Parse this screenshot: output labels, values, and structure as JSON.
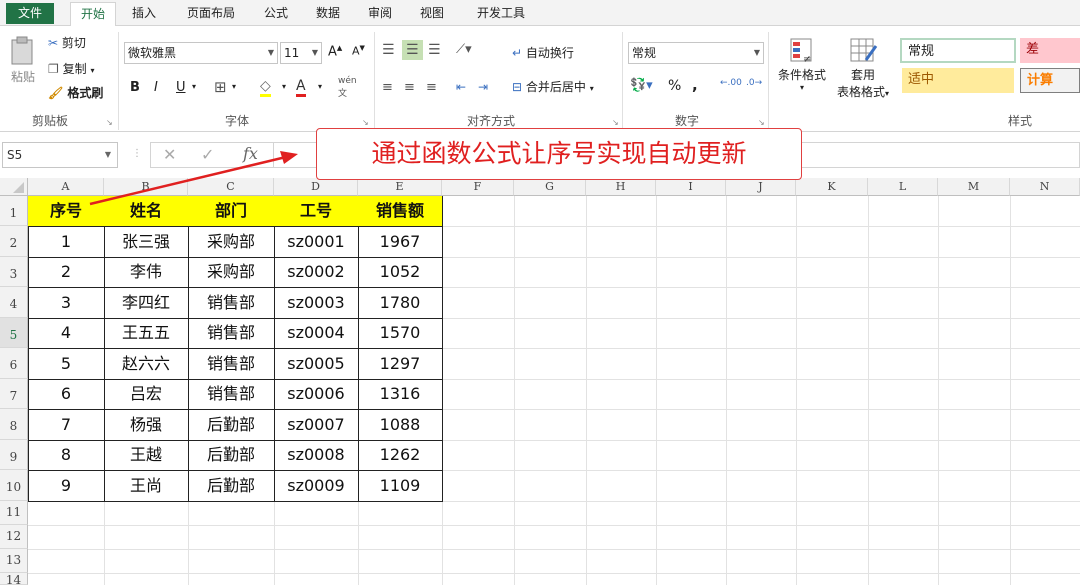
{
  "tabs": [
    "文件",
    "开始",
    "插入",
    "页面布局",
    "公式",
    "数据",
    "审阅",
    "视图",
    "开发工具"
  ],
  "ribbon": {
    "clipboard": {
      "paste": "粘贴",
      "cut": "剪切",
      "copy": "复制",
      "format_painter": "格式刷",
      "label": "剪贴板"
    },
    "font": {
      "name": "微软雅黑",
      "size": "11",
      "bold": "B",
      "italic": "I",
      "underline": "U",
      "grow": "A",
      "shrink": "A",
      "color": "A",
      "phonetic": "wén",
      "label": "字体"
    },
    "alignment": {
      "wrap": "自动换行",
      "merge": "合并后居中",
      "label": "对齐方式"
    },
    "number": {
      "format": "常规",
      "percent": "%",
      "comma": ",",
      "inc_dec": ".00",
      "dec_dec": ".0",
      "label": "数字"
    },
    "styles": {
      "conditional": "条件格式",
      "table_line1": "套用",
      "table_line2": "表格格式",
      "normal": "常规",
      "bad": "差",
      "neutral": "适中",
      "calc": "计算",
      "label": "样式"
    }
  },
  "formula_bar": {
    "cell_ref": "S5",
    "cancel": "✕",
    "enter": "✓",
    "fx": "fx",
    "value": ""
  },
  "annotation": "通过函数公式让序号实现自动更新",
  "columns": [
    "A",
    "B",
    "C",
    "D",
    "E",
    "F",
    "G",
    "H",
    "I",
    "J",
    "K",
    "L",
    "M",
    "N"
  ],
  "rows": [
    "1",
    "2",
    "3",
    "4",
    "5",
    "6",
    "7",
    "8",
    "9",
    "10",
    "11",
    "12",
    "13",
    "14"
  ],
  "selected_row": "5",
  "table": {
    "headers": [
      "序号",
      "姓名",
      "部门",
      "工号",
      "销售额"
    ],
    "rows": [
      [
        "1",
        "张三强",
        "采购部",
        "sz0001",
        "1967"
      ],
      [
        "2",
        "李伟",
        "采购部",
        "sz0002",
        "1052"
      ],
      [
        "3",
        "李四红",
        "销售部",
        "sz0003",
        "1780"
      ],
      [
        "4",
        "王五五",
        "销售部",
        "sz0004",
        "1570"
      ],
      [
        "5",
        "赵六六",
        "销售部",
        "sz0005",
        "1297"
      ],
      [
        "6",
        "吕宏",
        "销售部",
        "sz0006",
        "1316"
      ],
      [
        "7",
        "杨强",
        "后勤部",
        "sz0007",
        "1088"
      ],
      [
        "8",
        "王越",
        "后勤部",
        "sz0008",
        "1262"
      ],
      [
        "9",
        "王尚",
        "后勤部",
        "sz0009",
        "1109"
      ]
    ]
  },
  "colors": {
    "accent": "#217346",
    "header_fill": "#ffff00",
    "annotation": "#e02020",
    "bad_fill": "#ffc7ce",
    "bad_text": "#9c0006",
    "neutral_fill": "#ffeb9c",
    "neutral_text": "#9c5700",
    "calc_fill": "#f2f2f2",
    "calc_text": "#fa7d00",
    "normal_border": "#b4d8c1"
  }
}
